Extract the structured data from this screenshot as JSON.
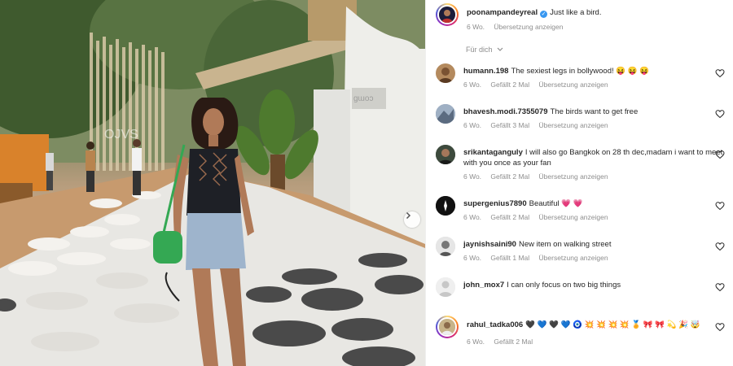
{
  "post": {
    "username": "poonampandeyreal",
    "caption": "Just like a bird.",
    "age": "6 Wo.",
    "translate": "Übersetzung anzeigen"
  },
  "filter_label": "Für dich",
  "comments": [
    {
      "username": "humann.198",
      "text": "The sexiest legs in bollywood! 😝 😝 😝",
      "age": "6 Wo.",
      "likes": "Gefällt 2 Mal",
      "translate": "Übersetzung anzeigen",
      "avatar_color": "#b48a5e"
    },
    {
      "username": "bhavesh.modi.7355079",
      "text": "The birds want to get free",
      "age": "6 Wo.",
      "likes": "Gefällt 3 Mal",
      "translate": "Übersetzung anzeigen",
      "avatar_color": "#7a8aa0"
    },
    {
      "username": "srikantaganguly",
      "text": "I will also go Bangkok on 28 th dec,madam i want to meet with you once as your fan",
      "age": "6 Wo.",
      "likes": "Gefällt 2 Mal",
      "translate": "Übersetzung anzeigen",
      "avatar_color": "#4a5a4a"
    },
    {
      "username": "supergenius7890",
      "text": "Beautiful 💗 💗",
      "age": "6 Wo.",
      "likes": "Gefällt 2 Mal",
      "translate": "Übersetzung anzeigen",
      "avatar_color": "#111111"
    },
    {
      "username": "jaynishsaini90",
      "text": "New item on walking street",
      "age": "6 Wo.",
      "likes": "Gefällt 1 Mal",
      "translate": "Übersetzung anzeigen",
      "avatar_color": "#c9c9c9"
    },
    {
      "username": "john_mox7",
      "text": "I can only focus on two big things",
      "age": "",
      "likes": "",
      "translate": "",
      "avatar_color": "#dbdbdb"
    },
    {
      "username": "rahul_tadka006",
      "text": "🖤 💙 🖤 💙 🧿 💥 💥 💥 💥 🏅 🎀 🎀 💫 🎉 🤯",
      "age": "6 Wo.",
      "likes": "Gefällt 2 Mal",
      "translate": "",
      "avatar_color": "#c7b48a"
    }
  ],
  "colors": {
    "verified": "#3897f0",
    "meta": "#8e8e8e",
    "text": "#262626"
  },
  "icons": {
    "verified": "verified-badge-icon",
    "heart": "heart-outline-icon",
    "chevron": "chevron-down-icon",
    "next": "chevron-right-icon"
  }
}
